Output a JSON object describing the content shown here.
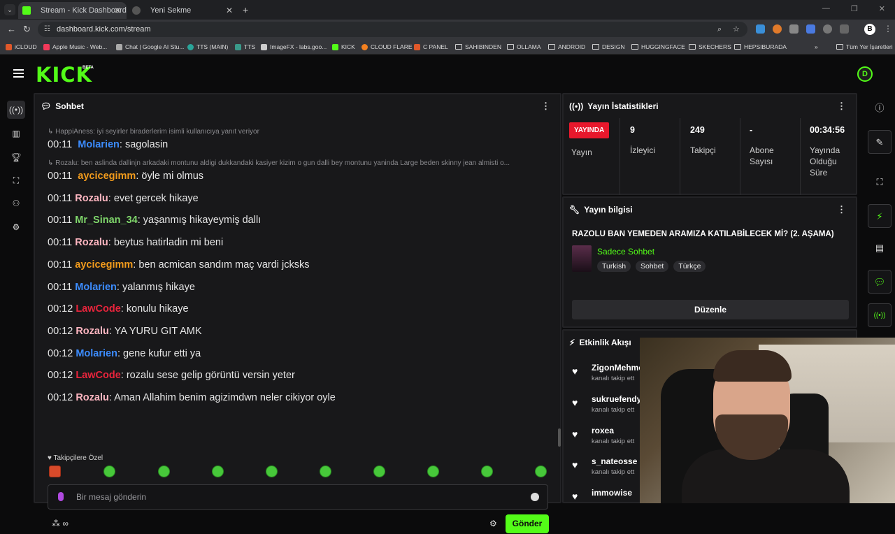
{
  "browser": {
    "tabs": [
      {
        "title": "Stream - Kick Dashboard",
        "active": true
      },
      {
        "title": "Yeni Sekme",
        "active": false
      }
    ],
    "url": "dashboard.kick.com/stream",
    "bookmarks": [
      "iCLOUD",
      "Apple Music - Web...",
      "Chat | Google AI Stu...",
      "TTS (MAIN)",
      "TTS",
      "ImageFX - labs.goo...",
      "KICK",
      "CLOUD FLARE",
      "C PANEL",
      "SAHIBINDEN",
      "OLLAMA",
      "ANDROID",
      "DESIGN",
      "HUGGINGFACE",
      "SKECHERS",
      "HEPSIBURADA"
    ],
    "all_bookmarks": "Tüm Yer İşaretleri",
    "profile_initial": "B"
  },
  "header": {
    "logo": "KICK",
    "beta": "BETA",
    "avatar": "D"
  },
  "chat": {
    "title": "Sohbet",
    "messages": [
      {
        "reply": "HappiAness: iyi seyirler biraderlerim isimli kullanıcıya yanıt veriyor",
        "time": "00:11",
        "user": "Molarien",
        "color": "#3c8cff",
        "text": "sagolasin"
      },
      {
        "reply": "Rozalu: ben aslinda dallinjn arkadaki montunu aldigi dukkandaki kasiyer kizim o gun dalli bey montunu yaninda Large beden skinny jean almisti o...",
        "time": "00:11",
        "user": "aycicegimm",
        "color": "#f29b1c",
        "text": "öyle mi olmus"
      },
      {
        "time": "00:11",
        "user": "Rozalu",
        "color": "#ffb6c1",
        "text": "evet gercek hikaye"
      },
      {
        "time": "00:11",
        "user": "Mr_Sinan_34",
        "color": "#7fd66b",
        "text": "yaşanmış hikayeymiş dallı"
      },
      {
        "time": "00:11",
        "user": "Rozalu",
        "color": "#ffb6c1",
        "text": "beytus hatirladin mi beni"
      },
      {
        "time": "00:11",
        "user": "aycicegimm",
        "color": "#f29b1c",
        "text": "ben acmican sandım maç vardi jcksks"
      },
      {
        "time": "00:11",
        "user": "Molarien",
        "color": "#3c8cff",
        "text": "yalanmış hikaye"
      },
      {
        "time": "00:12",
        "user": "LawCode",
        "color": "#e8243c",
        "text": "konulu hikaye"
      },
      {
        "time": "00:12",
        "user": "Rozalu",
        "color": "#ffb6c1",
        "text": "YA YURU GIT AMK"
      },
      {
        "time": "00:12",
        "user": "Molarien",
        "color": "#3c8cff",
        "text": "gene kufur etti ya"
      },
      {
        "time": "00:12",
        "user": "LawCode",
        "color": "#e8243c",
        "text": "rozalu sese gelip görüntü versin yeter"
      },
      {
        "time": "00:12",
        "user": "Rozalu",
        "color": "#ffb6c1",
        "text": "Aman Allahim benim agizimdwn neler cikiyor oyle"
      }
    ],
    "followers_only": "Takipçilere Özel",
    "input_placeholder": "Bir mesaj gönderin",
    "send_label": "Gönder",
    "infinity": "∞"
  },
  "stats": {
    "title": "Yayın İstatistikleri",
    "live_badge": "YAYINDA",
    "live_label": "Yayın",
    "viewers_value": "9",
    "viewers_label": "İzleyici",
    "followers_value": "249",
    "followers_label": "Takipçi",
    "subs_value": "-",
    "subs_label": "Abone Sayısı",
    "duration_value": "00:34:56",
    "duration_label": "Yayında Olduğu Süre"
  },
  "stream_info": {
    "title": "Yayın bilgisi",
    "stream_title": "RAZOLU BAN YEMEDEN ARAMIZA KATILABİLECEK Mİ? (2. AŞAMA)",
    "category": "Sadece Sohbet",
    "tags": [
      "Turkish",
      "Sohbet",
      "Türkçe"
    ],
    "edit_label": "Düzenle"
  },
  "activity": {
    "title": "Etkinlik Akışı",
    "items": [
      {
        "name": "ZigonMehme",
        "sub": "kanalı takip ett"
      },
      {
        "name": "sukruefendy",
        "sub": "kanalı takip ett"
      },
      {
        "name": "roxea",
        "sub": "kanalı takip ett"
      },
      {
        "name": "s_nateosse",
        "sub": "kanalı takip ett"
      },
      {
        "name": "immowise",
        "sub": ""
      }
    ]
  },
  "colors": {
    "accent": "#53fc18",
    "live": "#e8182c"
  }
}
